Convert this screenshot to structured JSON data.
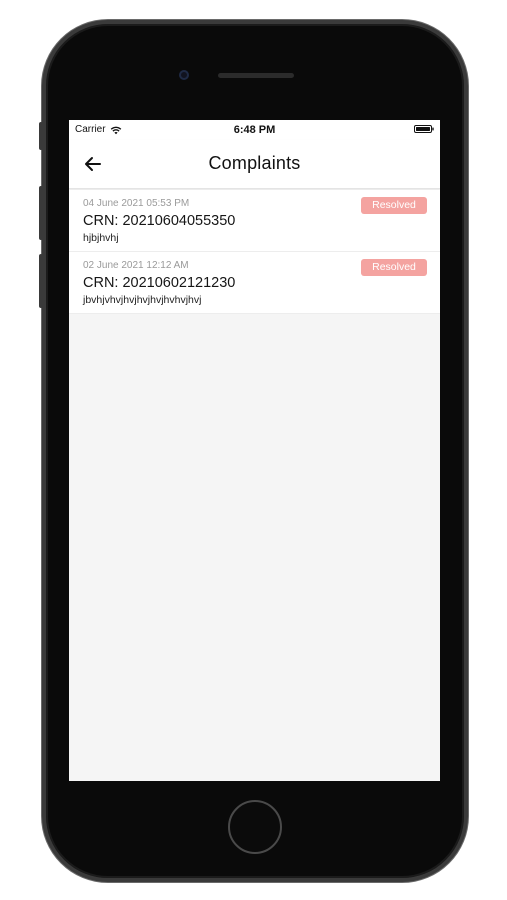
{
  "status_bar": {
    "carrier": "Carrier",
    "time": "6:48 PM"
  },
  "header": {
    "title": "Complaints",
    "back_icon": "arrow-left-icon"
  },
  "complaints": [
    {
      "date": "04 June 2021 05:53 PM",
      "crn": "CRN: 20210604055350",
      "description": "hjbjhvhj",
      "status": "Resolved"
    },
    {
      "date": "02 June 2021 12:12 AM",
      "crn": "CRN: 20210602121230",
      "description": "jbvhjvhvjhvjhvjhvjhvhvjhvj",
      "status": "Resolved"
    }
  ],
  "colors": {
    "badge_resolved": "#f4a3a0",
    "screen_background": "#f5f5f5",
    "device_frame": "#0a0a0a"
  }
}
